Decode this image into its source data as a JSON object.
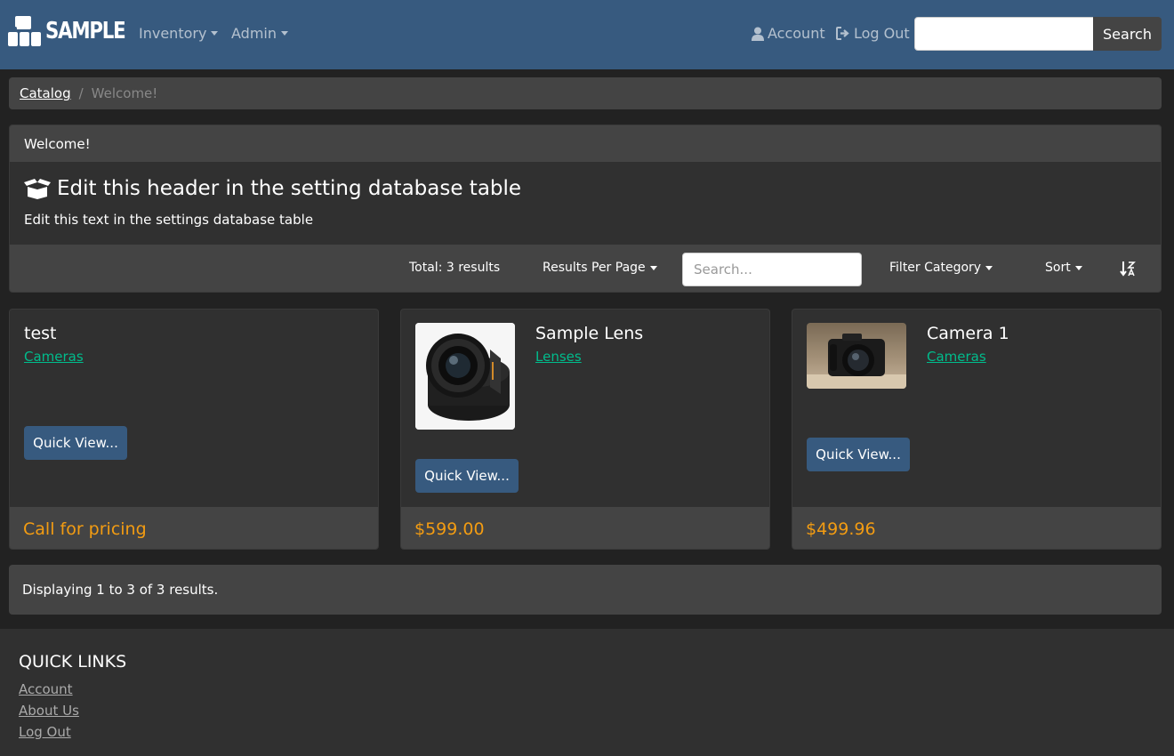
{
  "colors": {
    "navbar": "#375a7f",
    "background": "#222222",
    "card": "#303030",
    "panel": "#444444",
    "link_accent": "#00bc8c",
    "price": "#f39c12"
  },
  "navbar": {
    "brand": "SAMPLE",
    "brand_icon": "boxes-icon",
    "menus": [
      {
        "label": "Inventory"
      },
      {
        "label": "Admin"
      }
    ],
    "account_label": "Account",
    "account_icon": "user-icon",
    "logout_label": "Log Out",
    "logout_icon": "sign-out-icon",
    "search_value": "",
    "search_button": "Search"
  },
  "breadcrumb": {
    "items": [
      "Catalog",
      "Welcome!"
    ]
  },
  "welcome": {
    "card_header": "Welcome!",
    "title": "Edit this header in the setting database table",
    "title_icon": "box-open-icon",
    "text": "Edit this text in the settings database table"
  },
  "toolbar": {
    "total": "Total: 3 results",
    "per_page": "Results Per Page",
    "search_placeholder": "Search...",
    "filter": "Filter Category",
    "sort": "Sort",
    "sort_icon": "sort-alpha-icon"
  },
  "products": [
    {
      "title": "test",
      "category": "Cameras",
      "button": "Quick View...",
      "price": "Call for pricing"
    },
    {
      "title": "Sample Lens",
      "category": "Lenses",
      "button": "Quick View...",
      "price": "$599.00",
      "image": "lens-image"
    },
    {
      "title": "Camera 1",
      "category": "Cameras",
      "button": "Quick View...",
      "price": "$499.96",
      "image": "camera-image"
    }
  ],
  "results_text": "Displaying 1 to 3 of 3 results.",
  "footer": {
    "title": "QUICK LINKS",
    "links": [
      "Account",
      "About Us",
      "Log Out"
    ]
  }
}
